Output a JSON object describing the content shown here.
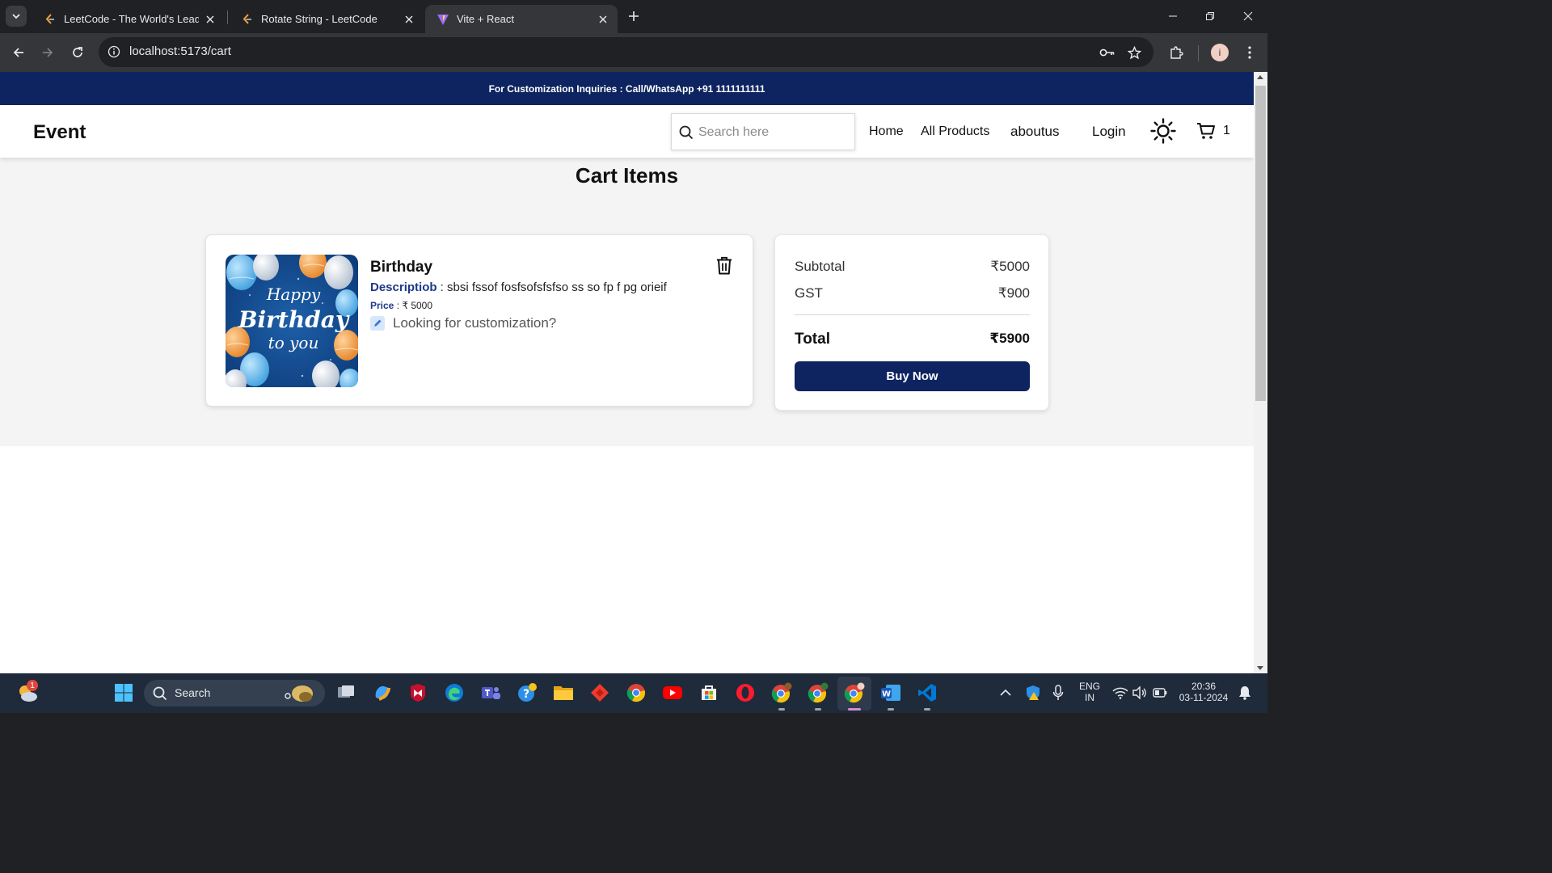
{
  "browser": {
    "tabs": [
      {
        "title": "LeetCode - The World's Leading",
        "active": false
      },
      {
        "title": "Rotate String - LeetCode",
        "active": false
      },
      {
        "title": "Vite + React",
        "active": true
      }
    ],
    "url": "localhost:5173/cart",
    "profile_initial": "i"
  },
  "promo": {
    "text": "For Customization Inquiries : Call/WhatsApp +91 1111111111"
  },
  "navbar": {
    "brand": "Event",
    "search_placeholder": "Search here",
    "links": [
      "Home",
      "All Products",
      "aboutus",
      "Login"
    ],
    "cart_count": "1"
  },
  "cart": {
    "title": "Cart Items",
    "items": [
      {
        "name": "Birthday",
        "description_label": "Descriptiob",
        "description": " : sbsi fssof fosfsofsfsfso ss so fp f pg orieif",
        "price_label": "Price",
        "price": " : ₹ 5000",
        "customization_text": "Looking for customization?",
        "image_text": [
          "Happy",
          "Birthday",
          "to you"
        ]
      }
    ]
  },
  "summary": {
    "subtotal_label": "Subtotal",
    "subtotal": "₹5000",
    "gst_label": "GST",
    "gst": "₹900",
    "total_label": "Total",
    "total": "₹5900",
    "buy_label": "Buy Now"
  },
  "taskbar": {
    "search_label": "Search",
    "notification_badge": "1",
    "lang_line1": "ENG",
    "lang_line2": "IN",
    "time": "20:36",
    "date": "03-11-2024"
  },
  "colors": {
    "brand_navy": "#0d2460",
    "label_blue": "#1d3a8a",
    "page_bg": "#f4f4f5"
  }
}
